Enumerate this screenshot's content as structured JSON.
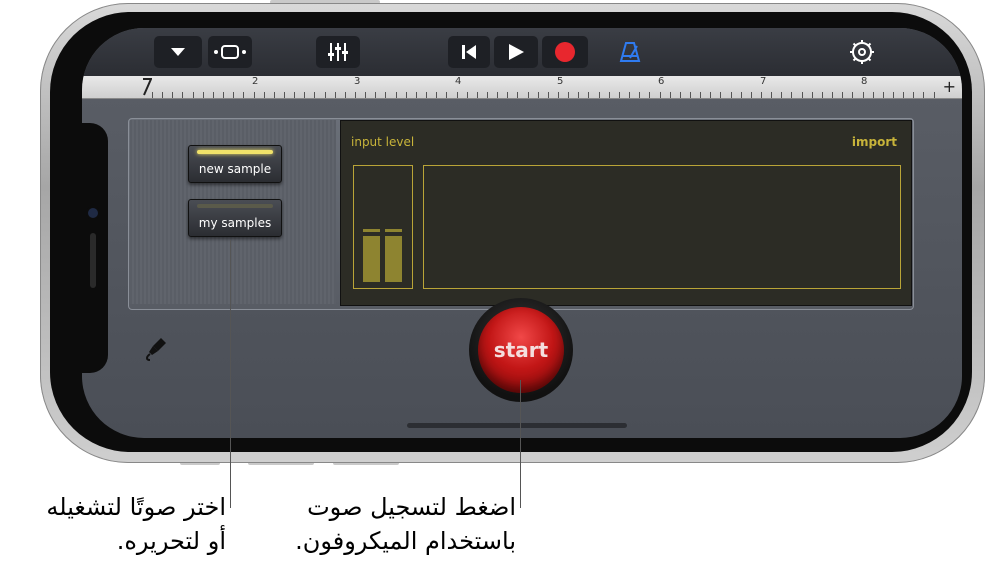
{
  "toolbar": {
    "items": [
      "dropdown-icon",
      "tracks-view-icon",
      "mixer-icon",
      "go-to-beginning-icon",
      "play-icon",
      "record-icon",
      "metronome-icon",
      "settings-icon"
    ]
  },
  "ruler": {
    "labels": [
      "2",
      "3",
      "4",
      "5",
      "6",
      "7",
      "8"
    ],
    "add": "+"
  },
  "sampler": {
    "new_sample": "new sample",
    "my_samples": "my samples",
    "input_level": "input level",
    "import": "import",
    "start": "start"
  },
  "colors": {
    "accent_yellow": "#c8b43a",
    "record_red": "#e8272e",
    "metronome_blue": "#2f7bf0"
  },
  "captions": {
    "left_line1": "اختر صوتًا لتشغيله",
    "left_line2": "أو لتحريره.",
    "right_line1": "اضغط لتسجيل صوت",
    "right_line2": "باستخدام الميكروفون."
  }
}
